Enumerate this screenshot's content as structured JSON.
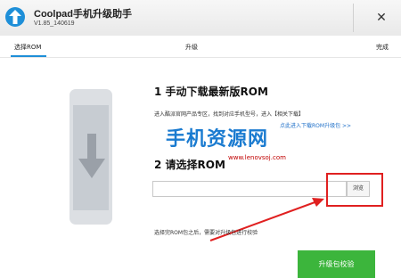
{
  "window": {
    "app_name": "Coolpad手机升级助手",
    "version": "V1.85_140619",
    "close_glyph": "✕"
  },
  "steps": [
    {
      "label": "选择ROM",
      "active": true
    },
    {
      "label": "升级",
      "active": false
    },
    {
      "label": "完成",
      "active": false
    }
  ],
  "section1": {
    "heading": "1 手动下载最新版ROM",
    "description": "进入酷派官网产品专区，找到对应手机型号，进入【相关下载】",
    "link": "点此进入下载ROM升级包 >>"
  },
  "section2": {
    "heading": "2 请选择ROM",
    "path_value": "",
    "browse_label": "浏览",
    "hint": "选择完ROM包之后，需要对升级包进行校验"
  },
  "watermark": {
    "text": "手机资源网",
    "url": "www.lenovsoj.com"
  },
  "footer": {
    "upgrade_label": "升级包校验"
  },
  "colors": {
    "accent": "#1e8fd8",
    "primary_button": "#3cb53c",
    "annotation": "#e02020"
  },
  "icons": {
    "app": "upload-arrow-icon",
    "phone": "phone-download-icon"
  }
}
